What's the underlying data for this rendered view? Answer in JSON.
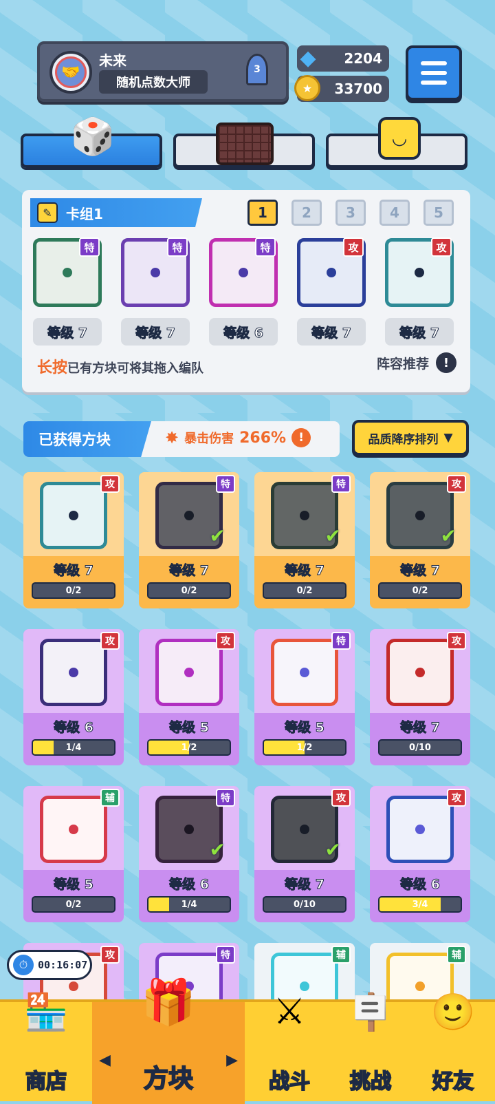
{
  "header": {
    "player_name": "未来",
    "player_title": "随机点数大师",
    "rank_level": "3",
    "gems": "2204",
    "coins": "33700"
  },
  "tabs": [
    {
      "name": "dice-tab",
      "icon": "dice-icon"
    },
    {
      "name": "board-tab",
      "icon": "board-icon"
    },
    {
      "name": "emote-tab",
      "icon": "smile-icon"
    }
  ],
  "deck": {
    "label": "卡组1",
    "tabs": [
      "1",
      "2",
      "3",
      "4",
      "5"
    ],
    "active_tab": "1",
    "cards": [
      {
        "tag": "特",
        "tag_type": "te",
        "level": "等级 7",
        "frame": "#2e7a5a",
        "bg": "#e8efe9",
        "dot": "#2e7a5a"
      },
      {
        "tag": "特",
        "tag_type": "te",
        "level": "等级 7",
        "frame": "#6b3fb0",
        "bg": "#ece6f7",
        "dot": "#4a3aa8"
      },
      {
        "tag": "特",
        "tag_type": "te",
        "level": "等级 6",
        "frame": "#c02fb0",
        "bg": "#f4eaf6",
        "dot": "#4a3aa8"
      },
      {
        "tag": "攻",
        "tag_type": "gong",
        "level": "等级 7",
        "frame": "#2b3f9a",
        "bg": "#e6ebf7",
        "dot": "#2b3f9a"
      },
      {
        "tag": "攻",
        "tag_type": "gong",
        "level": "等级 7",
        "frame": "#2e8a96",
        "bg": "#e6f3f5",
        "dot": "#1d2a44"
      }
    ],
    "hint_highlight": "长按",
    "hint_text": "已有方块可将其拖入编队",
    "lineup_label": "阵容推荐",
    "lineup_info": "!"
  },
  "acquired": {
    "label": "已获得方块",
    "crit_label": "暴击伤害",
    "crit_value": "266%",
    "crit_info": "!",
    "sort_label": "品质降序排列",
    "sort_arrow": "▼"
  },
  "grid_cards": [
    {
      "rarity": "gold",
      "tag": "攻",
      "tag_type": "gong",
      "level": "等级 7",
      "progress": "0/2",
      "fill": 0,
      "frame": "#2e8a96",
      "bg": "#e6f3f5",
      "dot": "#1d2a44",
      "dim": false,
      "checked": false
    },
    {
      "rarity": "gold",
      "tag": "特",
      "tag_type": "te",
      "level": "等级 7",
      "progress": "0/2",
      "fill": 0,
      "frame": "#4a3a7a",
      "bg": "#8a8a96",
      "dot": "#1d2a44",
      "dim": true,
      "checked": true
    },
    {
      "rarity": "gold",
      "tag": "特",
      "tag_type": "te",
      "level": "等级 7",
      "progress": "0/2",
      "fill": 0,
      "frame": "#2e5a4a",
      "bg": "#8a9290",
      "dot": "#1d2a44",
      "dim": true,
      "checked": true
    },
    {
      "rarity": "gold",
      "tag": "攻",
      "tag_type": "gong",
      "level": "等级 7",
      "progress": "0/2",
      "fill": 0,
      "frame": "#2e5a66",
      "bg": "#7c8a92",
      "dot": "#1d2a44",
      "dim": true,
      "checked": true
    },
    {
      "rarity": "purple",
      "tag": "攻",
      "tag_type": "gong",
      "level": "等级 6",
      "progress": "1/4",
      "fill": 0.25,
      "frame": "#3a2e7a",
      "bg": "#f3f1f8",
      "dot": "#4a3aa8",
      "dim": false,
      "checked": false
    },
    {
      "rarity": "purple",
      "tag": "攻",
      "tag_type": "gong",
      "level": "等级 5",
      "progress": "1/2",
      "fill": 0.5,
      "frame": "#b02fc0",
      "bg": "#f6ecf8",
      "dot": "#b02fc0",
      "dim": false,
      "checked": false
    },
    {
      "rarity": "purple",
      "tag": "特",
      "tag_type": "te",
      "level": "等级 5",
      "progress": "1/2",
      "fill": 0.5,
      "frame": "#e8553b",
      "bg": "#f7f5fb",
      "dot": "#5a5ad6",
      "dim": false,
      "checked": false
    },
    {
      "rarity": "purple",
      "tag": "攻",
      "tag_type": "gong",
      "level": "等级 7",
      "progress": "0/10",
      "fill": 0,
      "frame": "#c42a2a",
      "bg": "#fbeeee",
      "dot": "#c42a2a",
      "dim": false,
      "checked": false
    },
    {
      "rarity": "purple",
      "tag": "辅",
      "tag_type": "fu",
      "level": "等级 5",
      "progress": "0/2",
      "fill": 0,
      "frame": "#d63a4a",
      "bg": "#fff5f6",
      "dot": "#d63a4a",
      "dim": false,
      "checked": false
    },
    {
      "rarity": "purple",
      "tag": "特",
      "tag_type": "te",
      "level": "等级 6",
      "progress": "1/4",
      "fill": 0.25,
      "frame": "#5a2a6a",
      "bg": "#8a6a8e",
      "dot": "#2a1d3a",
      "dim": true,
      "checked": true
    },
    {
      "rarity": "purple",
      "tag": "攻",
      "tag_type": "gong",
      "level": "等级 7",
      "progress": "0/10",
      "fill": 0,
      "frame": "#2a3a5a",
      "bg": "#6e7480",
      "dot": "#1d2a44",
      "dim": true,
      "checked": true
    },
    {
      "rarity": "purple",
      "tag": "攻",
      "tag_type": "gong",
      "level": "等级 6",
      "progress": "3/4",
      "fill": 0.75,
      "frame": "#2e50b8",
      "bg": "#eef1fb",
      "dot": "#5a5ad6",
      "dim": false,
      "checked": false
    },
    {
      "rarity": "purple",
      "tag": "攻",
      "tag_type": "gong",
      "level": "",
      "progress": "",
      "fill": 0,
      "frame": "#d64a3a",
      "bg": "#fbeeee",
      "dot": "#d64a3a",
      "dim": false,
      "checked": false
    },
    {
      "rarity": "purple",
      "tag": "特",
      "tag_type": "te",
      "level": "",
      "progress": "",
      "fill": 0,
      "frame": "#7b3cc7",
      "bg": "#f3eefb",
      "dot": "#7b3cc7",
      "dim": false,
      "checked": false
    },
    {
      "rarity": "white",
      "tag": "辅",
      "tag_type": "fu",
      "level": "",
      "progress": "",
      "fill": 0,
      "frame": "#3ec6d8",
      "bg": "#f2fbfd",
      "dot": "#3ec6d8",
      "dim": false,
      "checked": false
    },
    {
      "rarity": "white",
      "tag": "辅",
      "tag_type": "fu",
      "level": "",
      "progress": "",
      "fill": 0,
      "frame": "#f2c02a",
      "bg": "#fffaee",
      "dot": "#f2a02a",
      "dim": false,
      "checked": false
    }
  ],
  "timer": "00:16:07",
  "nav": {
    "shop": "商店",
    "blocks": "方块",
    "battle": "战斗",
    "challenge": "挑战",
    "friends": "好友",
    "left_arrow": "◀",
    "right_arrow": "▶"
  },
  "colors": {
    "accent_blue": "#2f86e5",
    "gold": "#ffd43b",
    "crit_orange": "#f06a2b",
    "tag_attack": "#d2343b",
    "tag_special": "#7b3cc7",
    "tag_support": "#2aa06a"
  }
}
